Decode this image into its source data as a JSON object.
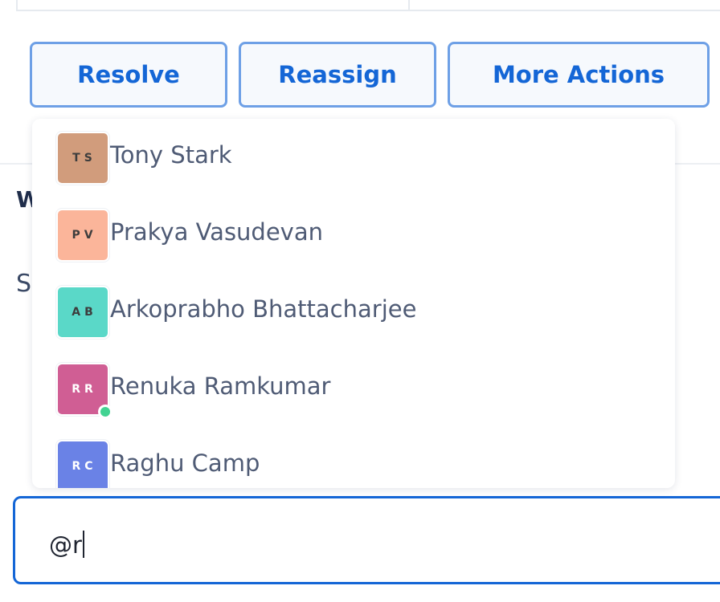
{
  "actions": {
    "resolve_label": "Resolve",
    "reassign_label": "Reassign",
    "more_actions_label": "More Actions"
  },
  "background": {
    "heading_fragment": "W",
    "text_fragment": "S"
  },
  "mention_dropdown": {
    "items": [
      {
        "initials": "TS",
        "name": "Tony Stark",
        "avatar_color": "#d19c7c",
        "initials_color": "#3d3d3d",
        "online": false
      },
      {
        "initials": "PV",
        "name": "Prakya Vasudevan",
        "avatar_color": "#fbb59a",
        "initials_color": "#3d3d3d",
        "online": false
      },
      {
        "initials": "AB",
        "name": "Arkoprabho Bhattacharjee",
        "avatar_color": "#5ad8c8",
        "initials_color": "#3d3d3d",
        "online": false
      },
      {
        "initials": "RR",
        "name": "Renuka Ramkumar",
        "avatar_color": "#d05e94",
        "initials_color": "#ffffff",
        "online": true
      },
      {
        "initials": "RC",
        "name": "Raghu Camp",
        "avatar_color": "#6a82e6",
        "initials_color": "#ffffff",
        "online": false
      }
    ]
  },
  "editor": {
    "value": "@r"
  },
  "colors": {
    "accent": "#1466d6",
    "button_border": "#6ea0e6",
    "online_indicator": "#42d392"
  }
}
